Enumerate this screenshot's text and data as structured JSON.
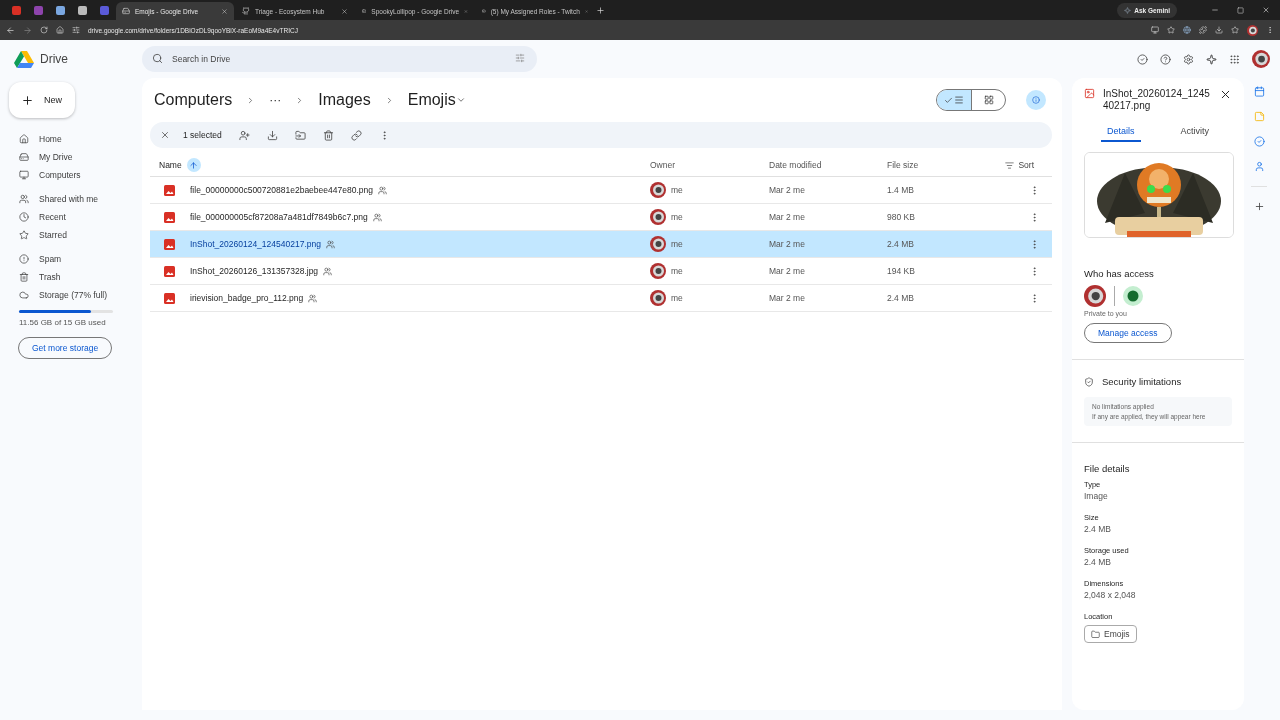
{
  "browser": {
    "tabs": [
      {
        "label": "Emojis - Google Drive",
        "selected": true
      },
      {
        "label": "Triage - Ecosystem Hub",
        "selected": false
      },
      {
        "label": "SpookyLollipop - Google Drive",
        "selected": false
      },
      {
        "label": "(5) My Assigned Roles - Twitch",
        "selected": false
      }
    ],
    "ask_button": "Ask Gemini",
    "address": "drive.google.com/drive/folders/1DBiOzDL9qooYBiX-raEoM9a4E4vTRICJ"
  },
  "drive": {
    "logo": "Drive",
    "search": {
      "placeholder": "Search in Drive"
    },
    "new_button": "New",
    "nav_groups": [
      [
        "Home",
        "My Drive",
        "Computers"
      ],
      [
        "Shared with me",
        "Recent",
        "Starred"
      ],
      [
        "Spam",
        "Trash",
        "Storage (77% full)"
      ]
    ],
    "storage": {
      "level": 0.77,
      "text": "11.56 GB of 15 GB used",
      "button": "Get more storage"
    }
  },
  "breadcrumbs": [
    "Computers",
    "···",
    "Images",
    "Emojis"
  ],
  "view_toggle": [
    {
      "kind": "list",
      "selected": true
    },
    {
      "kind": "grid",
      "selected": false
    }
  ],
  "selection": {
    "count": "1 selected"
  },
  "columns": [
    "Name",
    "Owner",
    "Date modified",
    "File size",
    "Sort"
  ],
  "rows": [
    {
      "name": "file_00000000c500720881e2baebee447e80.png",
      "owner": "me",
      "modified": "Mar 2 me",
      "size": "1.4 MB",
      "selected": false
    },
    {
      "name": "file_000000005cf87208a7a481df7849b6c7.png",
      "owner": "me",
      "modified": "Mar 2 me",
      "size": "980 KB",
      "selected": false
    },
    {
      "name": "InShot_20260124_124540217.png",
      "owner": "me",
      "modified": "Mar 2 me",
      "size": "2.4 MB",
      "selected": true
    },
    {
      "name": "InShot_20260126_131357328.jpg",
      "owner": "me",
      "modified": "Mar 2 me",
      "size": "194 KB",
      "selected": false
    },
    {
      "name": "irievision_badge_pro_112.png",
      "owner": "me",
      "modified": "Mar 2 me",
      "size": "2.4 MB",
      "selected": false
    }
  ],
  "panel": {
    "title": "InShot_20260124_124540217.png",
    "tabs": [
      {
        "label": "Details",
        "selected": true
      },
      {
        "label": "Activity",
        "selected": false
      }
    ],
    "access": {
      "title": "Who has access",
      "note": "Private to you",
      "button": "Manage access"
    },
    "security": {
      "title": "Security limitations",
      "lines": [
        "No limitations applied",
        "If any are applied, they will appear here"
      ]
    },
    "details": {
      "title": "File details",
      "fields": [
        {
          "label": "Type",
          "value": "Image"
        },
        {
          "label": "Size",
          "value": "2.4 MB"
        },
        {
          "label": "Storage used",
          "value": "2.4 MB"
        },
        {
          "label": "Dimensions",
          "value": "2,048 x 2,048"
        }
      ],
      "location_label": "Location",
      "location": "Emojis"
    }
  }
}
